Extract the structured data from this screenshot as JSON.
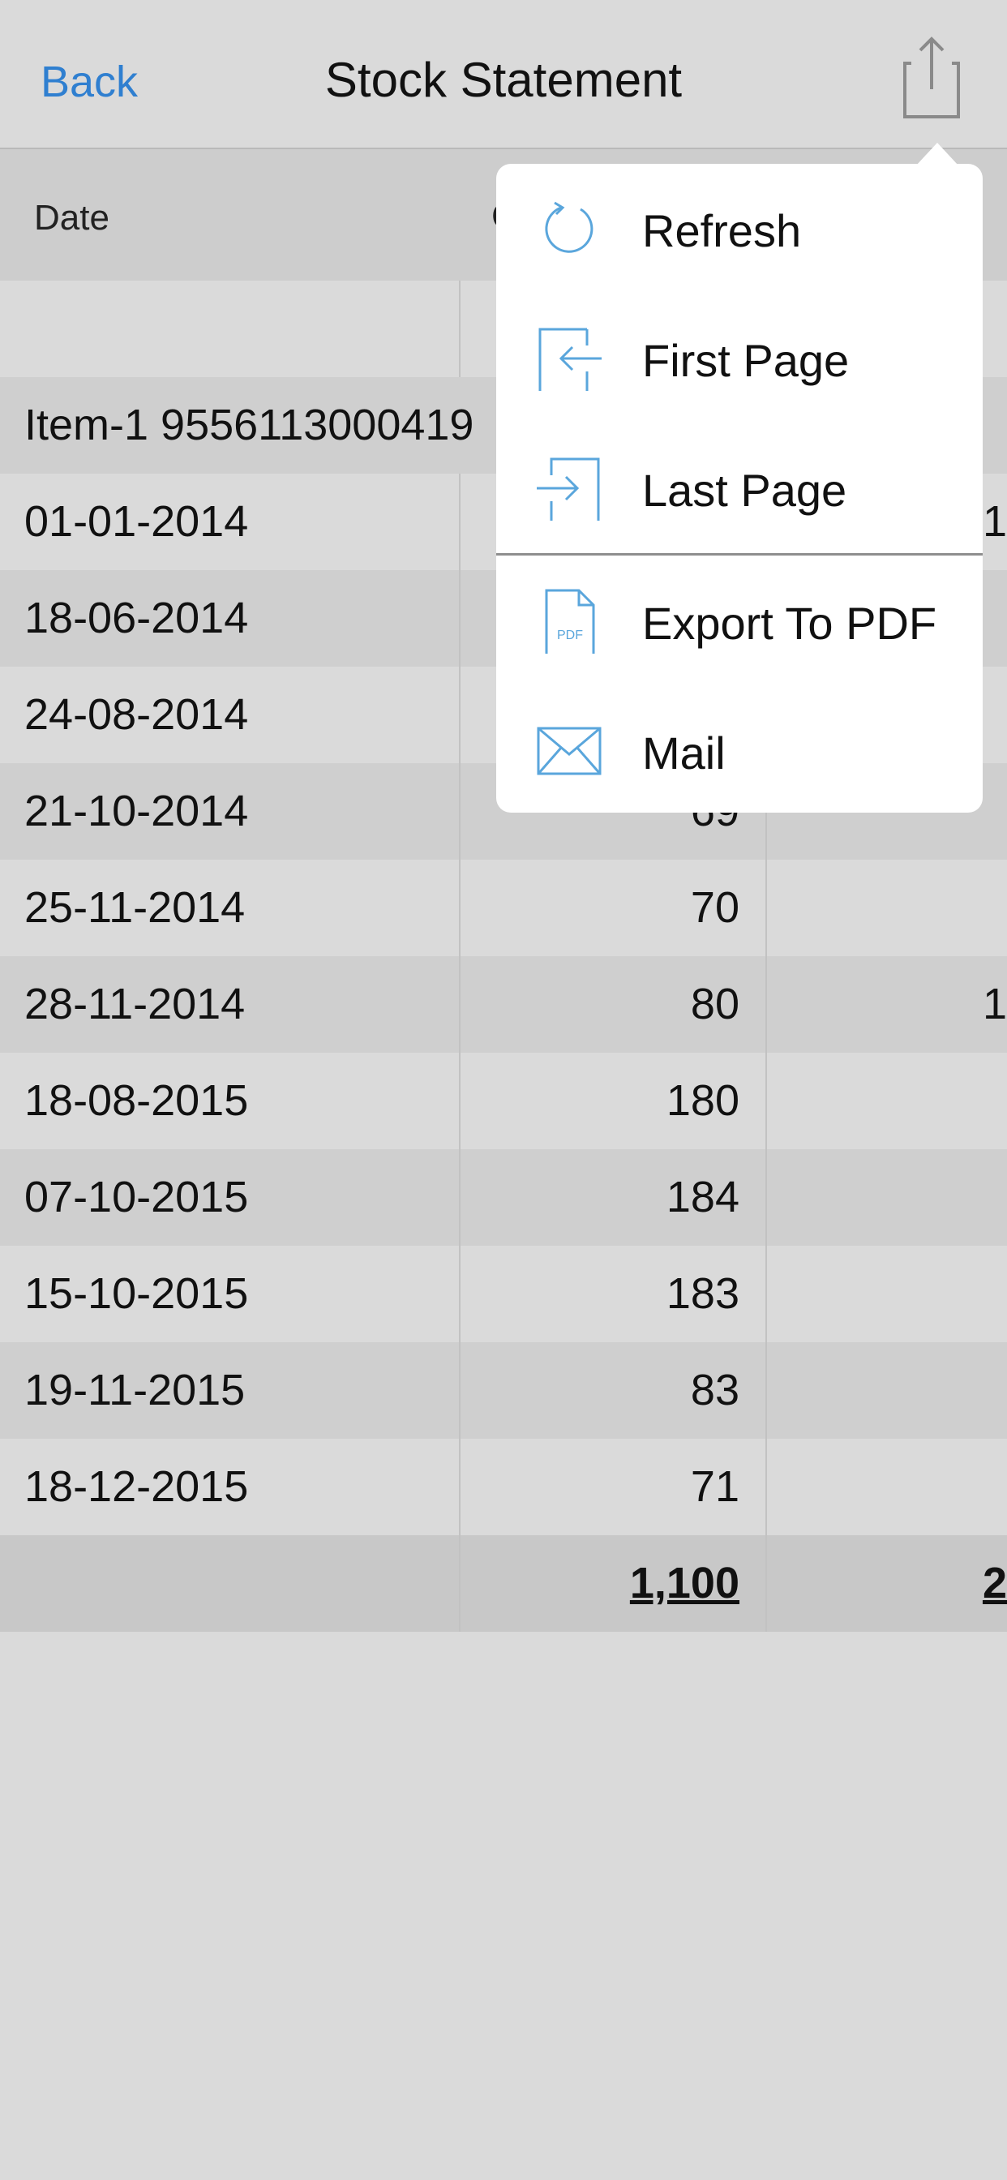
{
  "navbar": {
    "back_label": "Back",
    "title": "Stock Statement",
    "share_icon": "share-icon"
  },
  "table": {
    "header": {
      "date": "Date",
      "col2_fragment": "C"
    },
    "group_label": "Item-1 9556113000419",
    "rows": [
      {
        "date": "01-01-2014",
        "col2": "",
        "col3": "1"
      },
      {
        "date": "18-06-2014",
        "col2": "",
        "col3": ""
      },
      {
        "date": "24-08-2014",
        "col2": "",
        "col3": ""
      },
      {
        "date": "21-10-2014",
        "col2": "69",
        "col3": ""
      },
      {
        "date": "25-11-2014",
        "col2": "70",
        "col3": ""
      },
      {
        "date": "28-11-2014",
        "col2": "80",
        "col3": "1"
      },
      {
        "date": "18-08-2015",
        "col2": "180",
        "col3": ""
      },
      {
        "date": "07-10-2015",
        "col2": "184",
        "col3": ""
      },
      {
        "date": "15-10-2015",
        "col2": "183",
        "col3": ""
      },
      {
        "date": "19-11-2015",
        "col2": "83",
        "col3": ""
      },
      {
        "date": "18-12-2015",
        "col2": "71",
        "col3": ""
      }
    ],
    "total": {
      "col2": "1,100",
      "col3": "2"
    }
  },
  "menu": {
    "items": [
      {
        "label": "Refresh",
        "icon": "refresh-icon"
      },
      {
        "label": "First Page",
        "icon": "first-page-icon"
      },
      {
        "label": "Last Page",
        "icon": "last-page-icon"
      },
      {
        "label": "Export To PDF",
        "icon": "pdf-icon",
        "icon_text": "PDF"
      },
      {
        "label": "Mail",
        "icon": "mail-icon"
      }
    ]
  },
  "colors": {
    "accent": "#2f7fd0",
    "icon_blue": "#5aa6dc",
    "background": "#dadada",
    "row_alt": "#cfcfcf"
  }
}
